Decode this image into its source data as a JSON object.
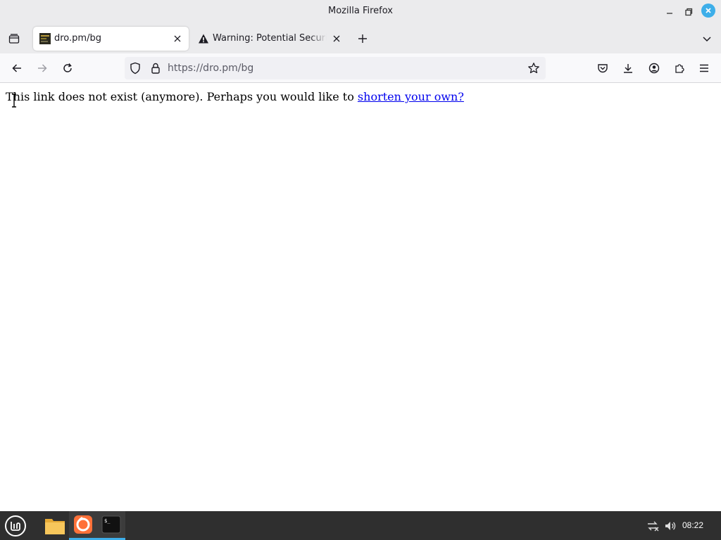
{
  "window": {
    "title": "Mozilla Firefox"
  },
  "tabs": [
    {
      "label": "dro.pm/bg",
      "active": true,
      "icon": "site-favicon"
    },
    {
      "label": "Warning: Potential Security Risk Ahead",
      "active": false,
      "icon": "warning-icon"
    }
  ],
  "navbar": {
    "url": "https://dro.pm/bg",
    "icons": [
      "back-icon",
      "forward-icon",
      "reload-icon",
      "shield-icon",
      "lock-icon",
      "star-icon",
      "pocket-icon",
      "download-icon",
      "account-icon",
      "extensions-icon",
      "menu-icon"
    ]
  },
  "page": {
    "message": "This link does not exist (anymore). Perhaps you would like to ",
    "link_text": "shorten your own?"
  },
  "taskbar": {
    "clock": "08:22",
    "apps": [
      "mint-menu-icon",
      "files-icon",
      "firefox-icon",
      "terminal-icon"
    ]
  },
  "colors": {
    "accent": "#3daee9",
    "link": "#0000ee",
    "chrome_bg": "#ebebed",
    "taskbar_bg": "#2f2f2f"
  }
}
